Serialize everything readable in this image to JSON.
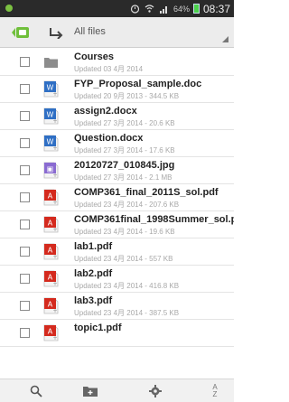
{
  "status_bar": {
    "battery_pct": "64%",
    "time": "08:37"
  },
  "toolbar": {
    "path_label": "All files"
  },
  "files": [
    {
      "name": "Courses",
      "meta": "Updated 03 4月 2014",
      "icon": "folder-icon"
    },
    {
      "name": "FYP_Proposal_sample.doc",
      "meta": "Updated 20 9月 2013 - 344.5 KB",
      "icon": "word-doc-icon"
    },
    {
      "name": "assign2.docx",
      "meta": "Updated 27 3月 2014 - 20.6 KB",
      "icon": "word-doc-icon"
    },
    {
      "name": "Question.docx",
      "meta": "Updated 27 3月 2014 - 17.6 KB",
      "icon": "word-doc-icon"
    },
    {
      "name": "20120727_010845.jpg",
      "meta": "Updated 27 3月 2014 - 2.1 MB",
      "icon": "image-file-icon"
    },
    {
      "name": "COMP361_final_2011S_sol.pdf",
      "meta": "Updated 23 4月 2014 - 207.6 KB",
      "icon": "pdf-icon"
    },
    {
      "name": "COMP361final_1998Summer_sol.pdf",
      "meta": "Updated 23 4月 2014 - 19.6 KB",
      "icon": "pdf-icon"
    },
    {
      "name": "lab1.pdf",
      "meta": "Updated 23 4月 2014 - 557 KB",
      "icon": "pdf-icon"
    },
    {
      "name": "lab2.pdf",
      "meta": "Updated 23 4月 2014 - 416.8 KB",
      "icon": "pdf-icon"
    },
    {
      "name": "lab3.pdf",
      "meta": "Updated 23 4月 2014 - 387.5 KB",
      "icon": "pdf-icon"
    },
    {
      "name": "topic1.pdf",
      "meta": "",
      "icon": "pdf-icon"
    }
  ],
  "bottom_bar": {
    "sort_label_top": "A",
    "sort_label_bottom": "Z"
  },
  "colors": {
    "accent_green": "#6fbf3a",
    "word_blue": "#2f6fc4",
    "pdf_red": "#d42a1e",
    "image_purple": "#8a6bd1",
    "folder_gray": "#8c8c8c"
  }
}
